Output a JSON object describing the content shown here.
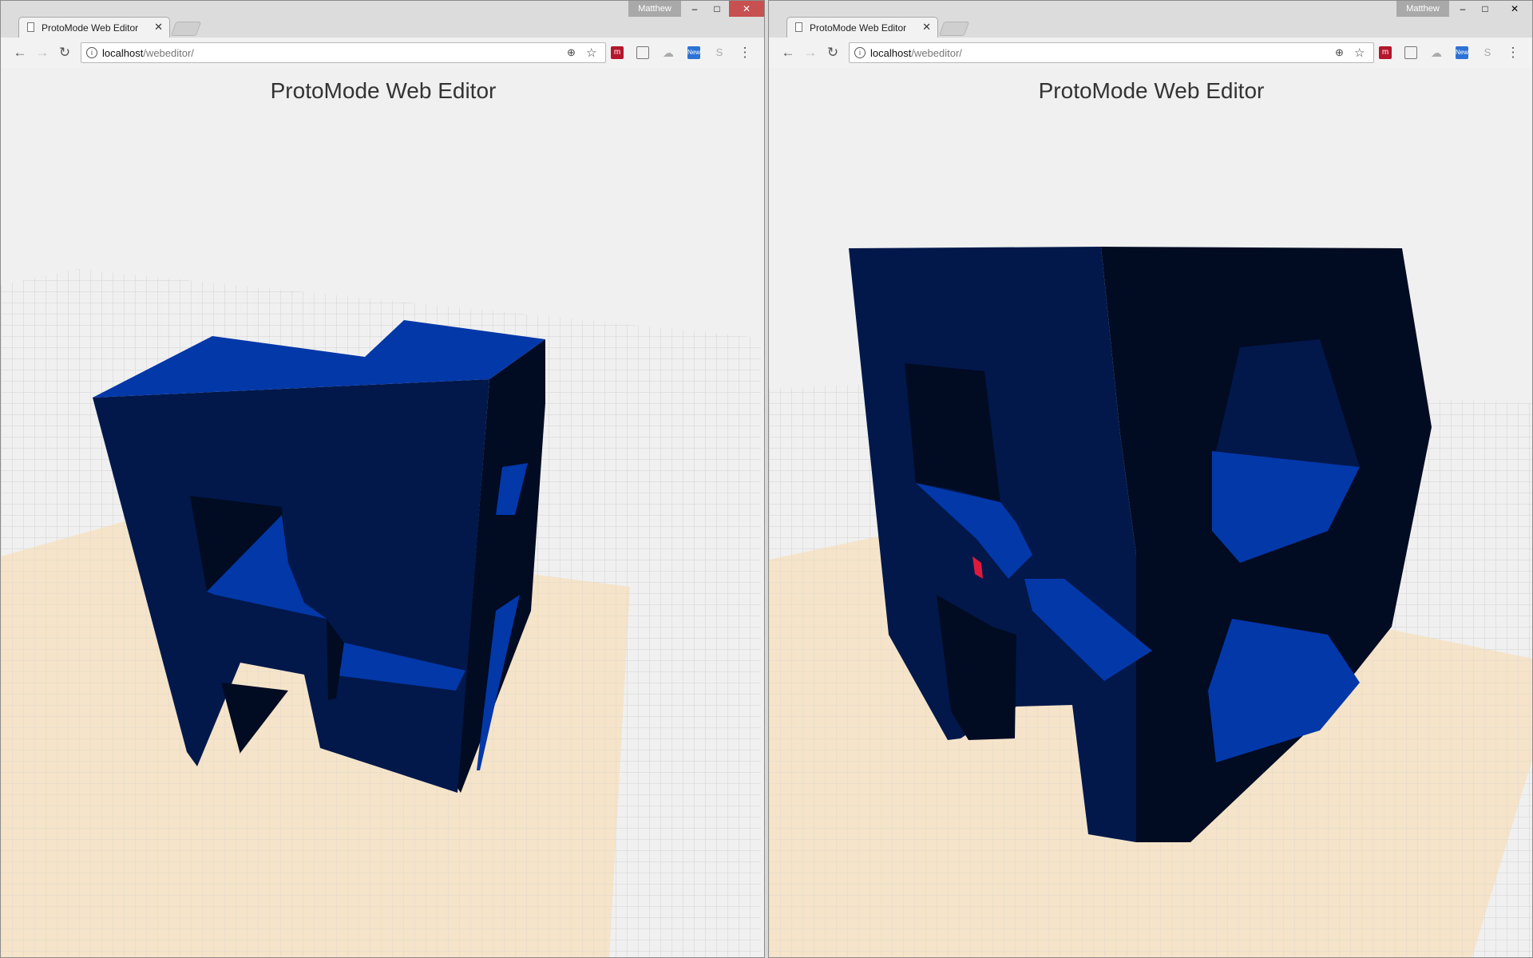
{
  "browser": {
    "profile_name": "Matthew",
    "tab_title": "ProtoMode Web Editor",
    "tab_close_glyph": "✕",
    "url_host": "localhost",
    "url_path": "/webeditor/",
    "window_controls": {
      "minimize": "–",
      "maximize": "□",
      "close": "✕"
    },
    "icons": {
      "back": "arrow-left-icon",
      "forward": "arrow-right-icon",
      "reload": "reload-icon",
      "info": "info-icon",
      "zoom": "zoom-icon",
      "bookmark": "star-icon",
      "menu": "kebab-menu-icon"
    },
    "extensions": [
      "red-extension-icon",
      "cast-icon",
      "cloud-extension-icon",
      "news-extension-icon",
      "skype-extension-icon"
    ],
    "extension_badge": "New"
  },
  "page": {
    "heading": "ProtoMode Web Editor",
    "colors": {
      "background": "#f0f0f0",
      "grid_line": "#d4d4d4",
      "build_plate": "#f6e2c2",
      "model_top": "#0338a9",
      "model_front": "#02184b",
      "model_shadow": "#010b22",
      "selection_marker": "#e0193c"
    }
  }
}
